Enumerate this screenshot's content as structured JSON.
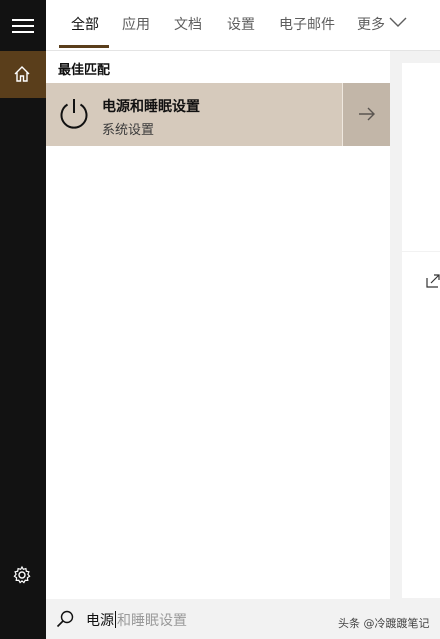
{
  "tabs": [
    {
      "label": "全部",
      "active": true
    },
    {
      "label": "应用"
    },
    {
      "label": "文档"
    },
    {
      "label": "设置"
    },
    {
      "label": "电子邮件"
    },
    {
      "label": "更多"
    }
  ],
  "icons": {
    "menu": "hamburger-icon",
    "home": "home-icon",
    "settings": "gear-icon",
    "result": "power-icon",
    "open": "arrow-right-icon",
    "search": "search-icon",
    "more": "chevron-down-icon",
    "preview": "open-external-icon"
  },
  "results": {
    "section_title": "最佳匹配",
    "best_match": {
      "title": "电源和睡眠设置",
      "subtitle": "系统设置"
    }
  },
  "search": {
    "typed": "电源",
    "suggestion": "和睡眠设置"
  },
  "watermark": "头条 @冷踱踱笔记",
  "colors": {
    "accent": "#5a3e1b",
    "selected_row": "#d6cabc",
    "rail": "#121212"
  }
}
